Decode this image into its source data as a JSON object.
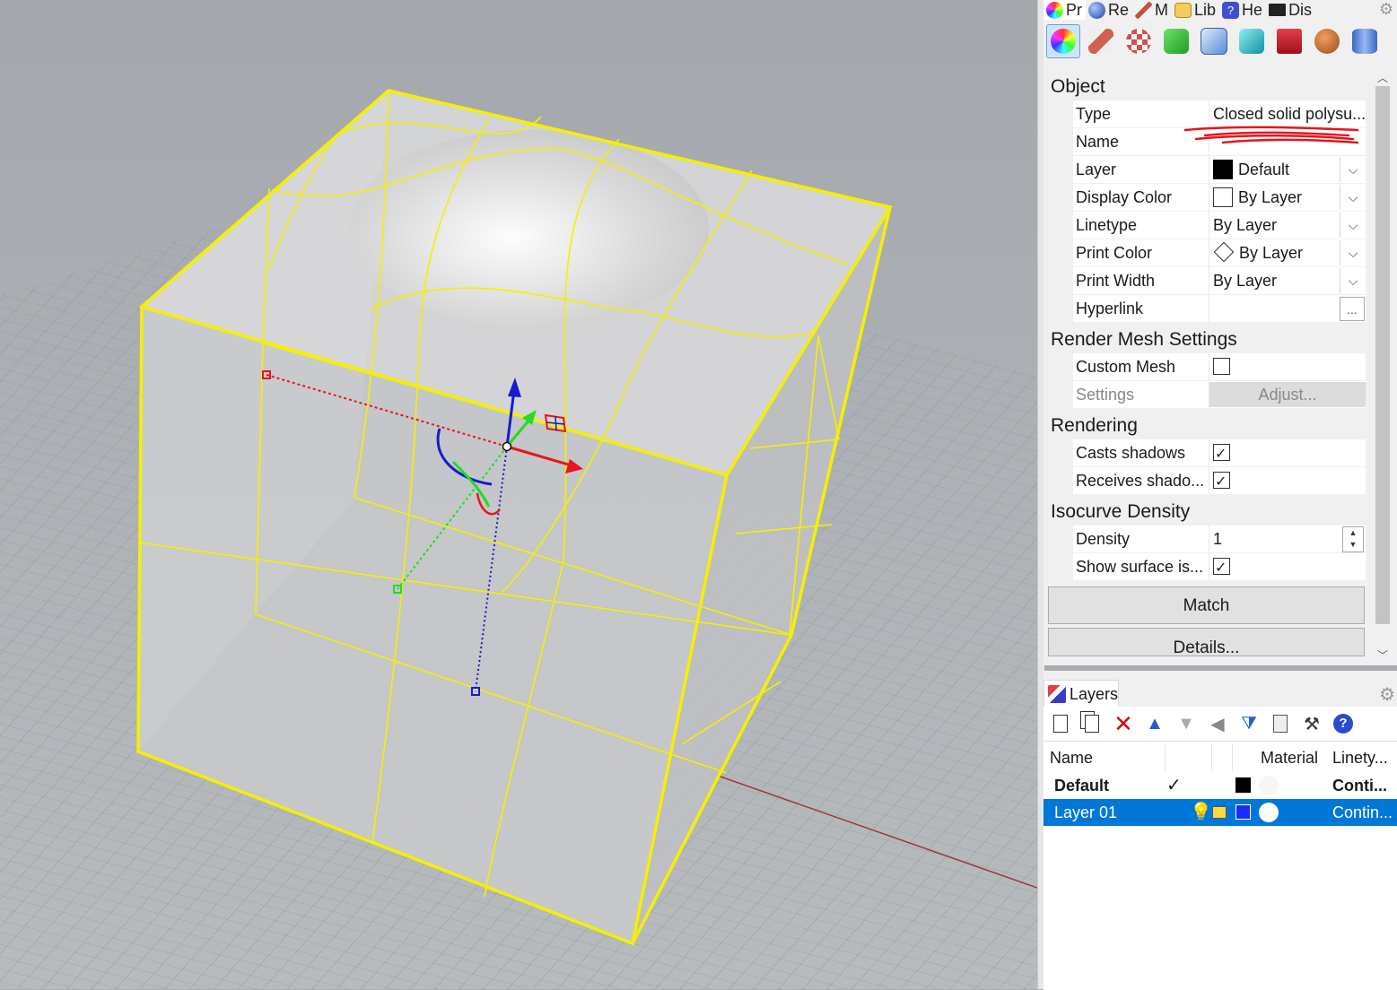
{
  "properties_panel": {
    "tabs": [
      {
        "label": "Pr",
        "icon": "color-wheel-icon",
        "color": "#e84b7a"
      },
      {
        "label": "Re",
        "icon": "render-sphere-icon",
        "color": "#3a6fd8"
      },
      {
        "label": "M",
        "icon": "brush-icon",
        "color": "#c85040"
      },
      {
        "label": "Lib",
        "icon": "folder-icon",
        "color": "#e5b94a"
      },
      {
        "label": "He",
        "icon": "help-book-icon",
        "color": "#4a5ad0"
      },
      {
        "label": "Dis",
        "icon": "monitor-icon",
        "color": "#222222"
      }
    ],
    "icon_row": [
      {
        "name": "object-properties-icon",
        "color": "#d04080"
      },
      {
        "name": "material-icon",
        "color": "#d06050"
      },
      {
        "name": "texture-mapping-icon",
        "color": "#d05050"
      },
      {
        "name": "decal-icon",
        "color": "#2fae2f"
      },
      {
        "name": "box-mapping-icon",
        "color": "#5a8ad8"
      },
      {
        "name": "cube-icon",
        "color": "#1fb0b8"
      },
      {
        "name": "toolbox-icon",
        "color": "#c0202a"
      },
      {
        "name": "sphere-texture-icon",
        "color": "#b8602a"
      },
      {
        "name": "cylinder-icon",
        "color": "#3868c8"
      }
    ],
    "sections": {
      "object": "Object",
      "render_mesh": "Render Mesh Settings",
      "rendering": "Rendering",
      "isocurve": "Isocurve Density"
    },
    "object": {
      "type_label": "Type",
      "type_value": "Closed solid polysu...",
      "name_label": "Name",
      "name_value": "",
      "layer_label": "Layer",
      "layer_value": "Default",
      "display_color_label": "Display Color",
      "display_color_value": "By Layer",
      "linetype_label": "Linetype",
      "linetype_value": "By Layer",
      "print_color_label": "Print Color",
      "print_color_value": "By Layer",
      "print_width_label": "Print Width",
      "print_width_value": "By Layer",
      "hyperlink_label": "Hyperlink",
      "hyperlink_button": "..."
    },
    "render_mesh": {
      "custom_mesh_label": "Custom Mesh",
      "custom_mesh_checked": false,
      "settings_label": "Settings",
      "adjust_button": "Adjust..."
    },
    "rendering": {
      "casts_label": "Casts shadows",
      "casts_checked": true,
      "receives_label": "Receives shado...",
      "receives_checked": true
    },
    "isocurve": {
      "density_label": "Density",
      "density_value": "1",
      "show_label": "Show surface is...",
      "show_checked": true
    },
    "match_button": "Match",
    "details_button": "Details..."
  },
  "layers_panel": {
    "tab_label": "Layers",
    "columns": {
      "name": "Name",
      "material": "Material",
      "linetype": "Linety..."
    },
    "rows": [
      {
        "name": "Default",
        "current": "✓",
        "color": "#000000",
        "linetype": "Conti...",
        "selected": false
      },
      {
        "name": "Layer 01",
        "current": "",
        "color": "#1a2cff",
        "linetype": "Contin...",
        "selected": true
      }
    ]
  },
  "colors": {
    "selection_yellow": "#f5f000",
    "viewport_bg": "#a8acb0",
    "accent_blue": "#0078d7",
    "annotation_red": "#e8141e"
  }
}
